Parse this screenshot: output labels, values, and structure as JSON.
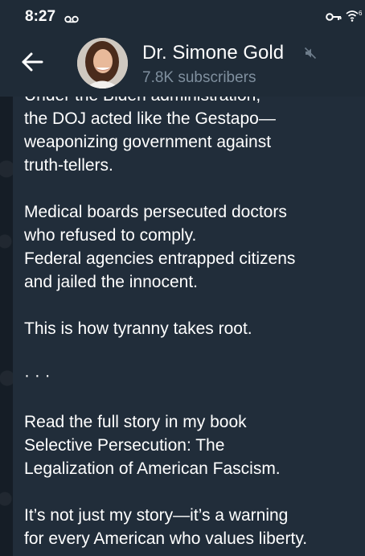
{
  "status_bar": {
    "time": "8:27",
    "voicemail_icon": "voicemail-icon",
    "key_icon": "vpn-key-icon",
    "wifi_icon": "wifi-icon",
    "wifi_badge": "6"
  },
  "header": {
    "channel_name": "Dr. Simone Gold",
    "subscribers": "7.8K subscribers",
    "back_icon": "back-arrow-icon",
    "muted_icon": "muted-speaker-icon"
  },
  "message": {
    "paragraphs": [
      [
        "Under the Biden administration,",
        "the DOJ acted like the Gestapo—",
        "weaponizing government against",
        "truth-tellers."
      ],
      [
        "Medical boards persecuted doctors",
        "who refused to comply.",
        "Federal agencies entrapped citizens",
        "and jailed the innocent."
      ],
      [
        "This is how tyranny takes root."
      ],
      [
        "· · ·"
      ],
      [
        "Read the full story in my book",
        "Selective Persecution: The",
        "Legalization of American Fascism."
      ],
      [
        "It’s not just my story—it’s a warning",
        "for every American who values liberty."
      ]
    ]
  },
  "colors": {
    "header_bg": "#1f2b37",
    "bubble_bg": "#212d3a",
    "subtle_text": "#7f8f9e"
  }
}
